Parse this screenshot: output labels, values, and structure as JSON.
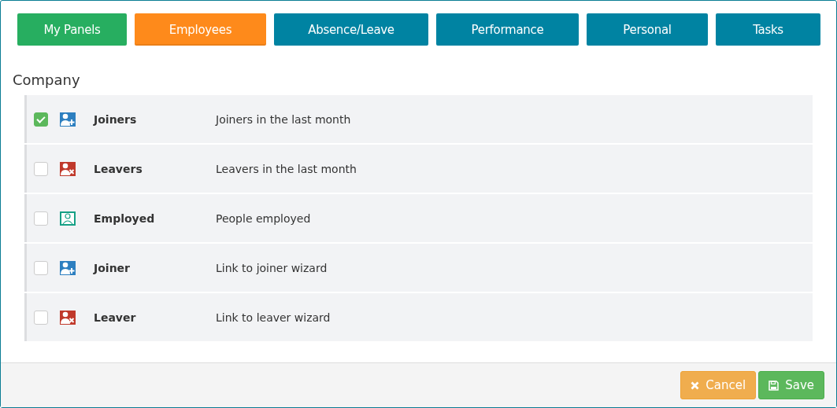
{
  "tabs": [
    {
      "label": "My Panels",
      "selected": false,
      "color": "#27ae60"
    },
    {
      "label": "Employees",
      "selected": true,
      "color": "#fe8a1b"
    },
    {
      "label": "Absence/Leave",
      "selected": false,
      "color": "#0083a2"
    },
    {
      "label": "Performance",
      "selected": false,
      "color": "#0083a2"
    },
    {
      "label": "Personal",
      "selected": false,
      "color": "#0083a2"
    },
    {
      "label": "Tasks",
      "selected": false,
      "color": "#0083a2"
    }
  ],
  "section": {
    "title": "Company"
  },
  "panels": [
    {
      "name": "Joiners",
      "description": "Joiners in the last month",
      "checked": true,
      "kind": "joiner"
    },
    {
      "name": "Leavers",
      "description": "Leavers in the last month",
      "checked": false,
      "kind": "leaver"
    },
    {
      "name": "Employed",
      "description": "People employed",
      "checked": false,
      "kind": "employed"
    },
    {
      "name": "Joiner",
      "description": "Link to joiner wizard",
      "checked": false,
      "kind": "joiner"
    },
    {
      "name": "Leaver",
      "description": "Link to leaver wizard",
      "checked": false,
      "kind": "leaver"
    }
  ],
  "buttons": [
    {
      "label": "Cancel",
      "kind": "cancel"
    },
    {
      "label": "Save",
      "kind": "save"
    }
  ]
}
